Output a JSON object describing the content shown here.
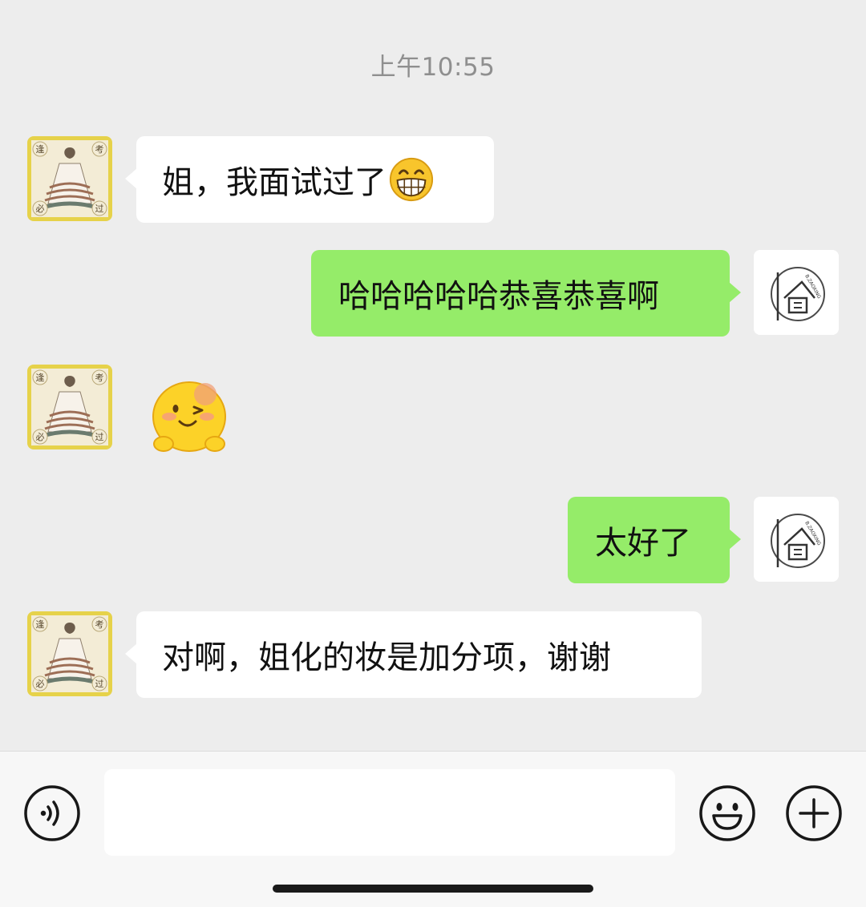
{
  "chat": {
    "timestamp": "上午10:55",
    "messages": [
      {
        "sender": "contact",
        "text": "姐，我面试过了",
        "emoji": "grin-emoji"
      },
      {
        "sender": "me",
        "text": "哈哈哈哈哈恭喜恭喜啊"
      },
      {
        "sender": "contact",
        "sticker": "cheeky-wink-emoji"
      },
      {
        "sender": "me",
        "text": "太好了"
      },
      {
        "sender": "contact",
        "text": "对啊，姐化的妆是加分项，谢谢"
      }
    ]
  },
  "avatars": {
    "contact": {
      "corner_labels": [
        "逢",
        "考",
        "必",
        "过"
      ]
    },
    "me": {
      "logo_text": "B.ZAOXING"
    }
  },
  "input_bar": {
    "value": "",
    "placeholder": "",
    "icons": [
      "voice-icon",
      "emoji-icon",
      "plus-icon"
    ]
  },
  "colors": {
    "background": "#ededed",
    "incoming_bubble": "#ffffff",
    "outgoing_bubble": "#95ec69",
    "timestamp_text": "#8f8f8f"
  }
}
